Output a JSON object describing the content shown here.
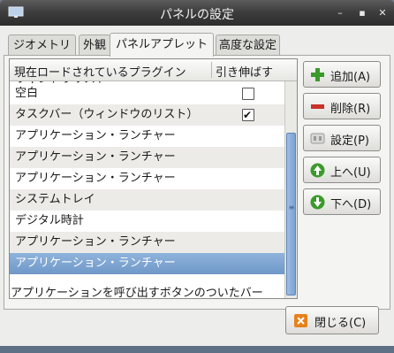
{
  "window": {
    "title": "パネルの設定"
  },
  "titlebar_buttons": [
    {
      "name": "minimize",
      "glyph": "–"
    },
    {
      "name": "maximize",
      "glyph": "▪"
    },
    {
      "name": "close",
      "glyph": "✕"
    }
  ],
  "tabs": [
    {
      "label": "ジオメトリ",
      "active": false
    },
    {
      "label": "外観",
      "active": false
    },
    {
      "label": "パネルアプレット",
      "active": true
    },
    {
      "label": "高度な設定",
      "active": false
    }
  ],
  "list": {
    "columns": [
      "現在ロードされているプラグイン",
      "引き伸ばす"
    ],
    "rows": [
      {
        "label": "ウィンドウリスト",
        "stretch": null,
        "partial": true
      },
      {
        "label": "空白",
        "stretch": false
      },
      {
        "label": "タスクバー（ウィンドウのリスト）",
        "stretch": true
      },
      {
        "label": "アプリケーション・ランチャー",
        "stretch": null
      },
      {
        "label": "アプリケーション・ランチャー",
        "stretch": null
      },
      {
        "label": "アプリケーション・ランチャー",
        "stretch": null
      },
      {
        "label": "システムトレイ",
        "stretch": null
      },
      {
        "label": "デジタル時計",
        "stretch": null
      },
      {
        "label": "アプリケーション・ランチャー",
        "stretch": null
      },
      {
        "label": "アプリケーション・ランチャー",
        "stretch": null,
        "selected": true
      }
    ],
    "scroll_position": 0.24
  },
  "side_buttons": [
    {
      "label": "追加(A)",
      "icon": "add-icon",
      "color": "#3a9a2a"
    },
    {
      "label": "削除(R)",
      "icon": "remove-icon",
      "color": "#c8322a"
    },
    {
      "label": "設定(P)",
      "icon": "preferences-icon",
      "color": "#9a9a9a"
    },
    {
      "label": "上へ(U)",
      "icon": "up-arrow-icon",
      "color": "#3a9a2a"
    },
    {
      "label": "下へ(D)",
      "icon": "down-arrow-icon",
      "color": "#3a9a2a"
    }
  ],
  "status": {
    "description": "アプリケーションを呼び出すボタンのついたバー"
  },
  "footer": {
    "close_label": "閉じる(C)",
    "close_icon_color": "#e8801a"
  }
}
